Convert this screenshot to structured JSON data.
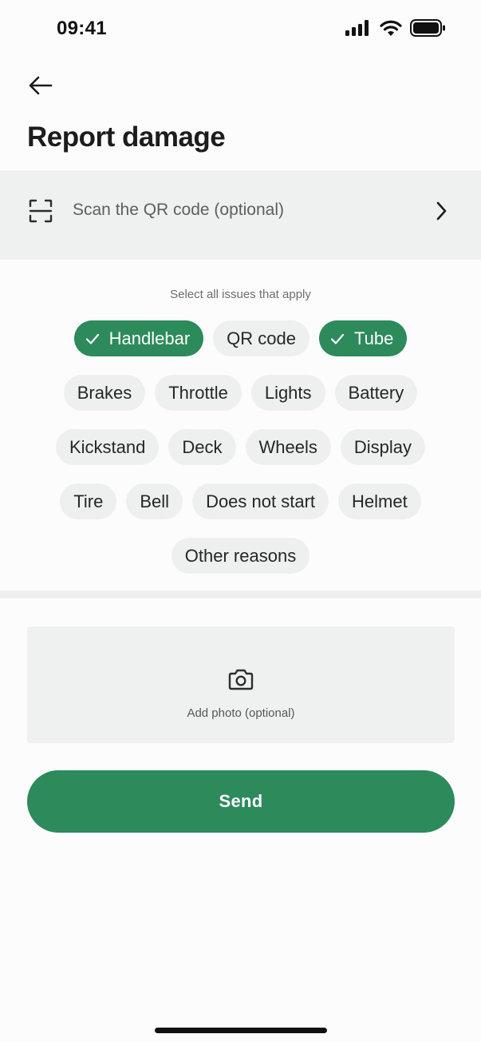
{
  "status_bar": {
    "time": "09:41",
    "icons": [
      "signal-icon",
      "wifi-icon",
      "battery-icon"
    ]
  },
  "header": {
    "back_icon": "arrow-left-icon",
    "title": "Report damage"
  },
  "qr": {
    "icon": "qr-scan-icon",
    "label": "Scan the QR code (optional)",
    "chevron": "chevron-right-icon"
  },
  "issues": {
    "hint": "Select all issues that apply",
    "rows": [
      [
        {
          "label": "Handlebar",
          "selected": true
        },
        {
          "label": "QR code",
          "selected": false
        },
        {
          "label": "Tube",
          "selected": true
        }
      ],
      [
        {
          "label": "Brakes",
          "selected": false
        },
        {
          "label": "Throttle",
          "selected": false
        },
        {
          "label": "Lights",
          "selected": false
        },
        {
          "label": "Battery",
          "selected": false
        }
      ],
      [
        {
          "label": "Kickstand",
          "selected": false
        },
        {
          "label": "Deck",
          "selected": false
        },
        {
          "label": "Wheels",
          "selected": false
        },
        {
          "label": "Display",
          "selected": false
        }
      ],
      [
        {
          "label": "Tire",
          "selected": false
        },
        {
          "label": "Bell",
          "selected": false
        },
        {
          "label": "Does not start",
          "selected": false
        },
        {
          "label": "Helmet",
          "selected": false
        }
      ],
      [
        {
          "label": "Other reasons",
          "selected": false
        }
      ]
    ]
  },
  "photo": {
    "icon": "camera-icon",
    "label": "Add photo (optional)"
  },
  "send": {
    "label": "Send"
  },
  "colors": {
    "accent": "#2c8a5b",
    "chip_bg": "#eef0ef",
    "panel_bg": "#eff1f1"
  }
}
